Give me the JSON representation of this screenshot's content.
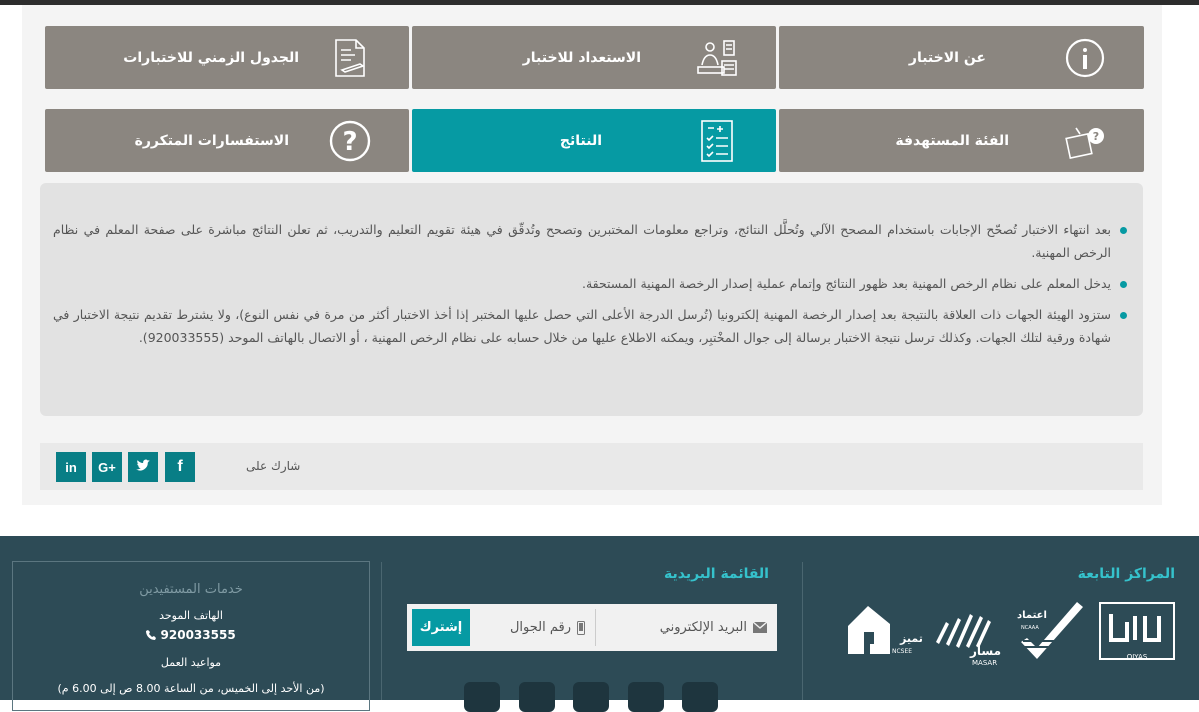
{
  "tiles": [
    {
      "label": "عن الاختبار",
      "icon": "info-icon",
      "active": false
    },
    {
      "label": "الاستعداد للاختبار",
      "icon": "study-icon",
      "active": false
    },
    {
      "label": "الجدول الزمني للاختبارات",
      "icon": "document-pen-icon",
      "active": false
    },
    {
      "label": "الفئة المستهدفة",
      "icon": "target-group-icon",
      "active": false
    },
    {
      "label": "النتائج",
      "icon": "results-checklist-icon",
      "active": true
    },
    {
      "label": "الاستفسارات المتكررة",
      "icon": "question-icon",
      "active": false
    }
  ],
  "info": {
    "items": [
      "بعد انتهاء الاختبار تُصحّح الإجابات باستخدام المصحح الآلي وتُحلَّل النتائج، وتراجع معلومات المختبرين وتصحح وتُدقّق في هيئة تقويم التعليم والتدريب، ثم تعلن النتائج مباشرة على صفحة المعلم في نظام الرخص المهنية.",
      "يدخل المعلم على نظام الرخص المهنية بعد ظهور النتائج وإتمام عملية إصدار الرخصة المهنية المستحقة.",
      "ستزود الهيئة الجهات ذات العلاقة بالنتيجة بعد إصدار الرخصة المهنية إلكترونيا (تُرسل الدرجة الأعلى التي حصل عليها المختبر إذا أخذ الاختبار أكثر من مرة في نفس النوع)، ولا يشترط تقديم نتيجة الاختبار في شهادة ورقية لتلك الجهات. وكذلك ترسل نتيجة الاختبار برسالة إلى جوال المخْتبِر، ويمكنه الاطلاع عليها من خلال حسابه على نظام الرخص المهنية ، أو الاتصال بالهاتف الموحد (920033555)."
    ]
  },
  "share": {
    "label": "شارك على",
    "buttons": [
      {
        "text": "in",
        "icon": "linkedin-icon"
      },
      {
        "text": "G+",
        "icon": "google-plus-icon"
      },
      {
        "text": "twitter",
        "icon": "twitter-icon"
      },
      {
        "text": "f",
        "icon": "facebook-icon"
      }
    ]
  },
  "footer": {
    "centers_title": "المراكز التابعة",
    "mailing_title": "القائمة البريدية",
    "subscribe": {
      "email_placeholder": "البريد الإلكتروني",
      "phone_placeholder": "رقم الجوال",
      "button": "إشترك"
    },
    "services": {
      "title": "خدمات المستفيدين",
      "phone_label": "الهاتف الموحد",
      "phone": "920033555",
      "hours_label": "مواعيد العمل",
      "hours": "(من الأحد إلى الخميس، من الساعة 8.00 ص إلى 6.00 م)"
    },
    "logos": {
      "qiyas": "QIYAS",
      "etimad": "اعتماد",
      "etimad_en": "NCAAA",
      "masar": "مسار",
      "masar_en": "MASAR",
      "tamayuz": "تميز",
      "tamayuz_en": "NCSEE"
    },
    "social": [
      "rss-icon",
      "linkedin-icon",
      "youtube-icon",
      "twitter-icon",
      "facebook-icon"
    ]
  },
  "colors": {
    "tile": "#8b8680",
    "active": "#069aa3",
    "footer": "#2d4b56",
    "accent": "#35c2cc"
  }
}
